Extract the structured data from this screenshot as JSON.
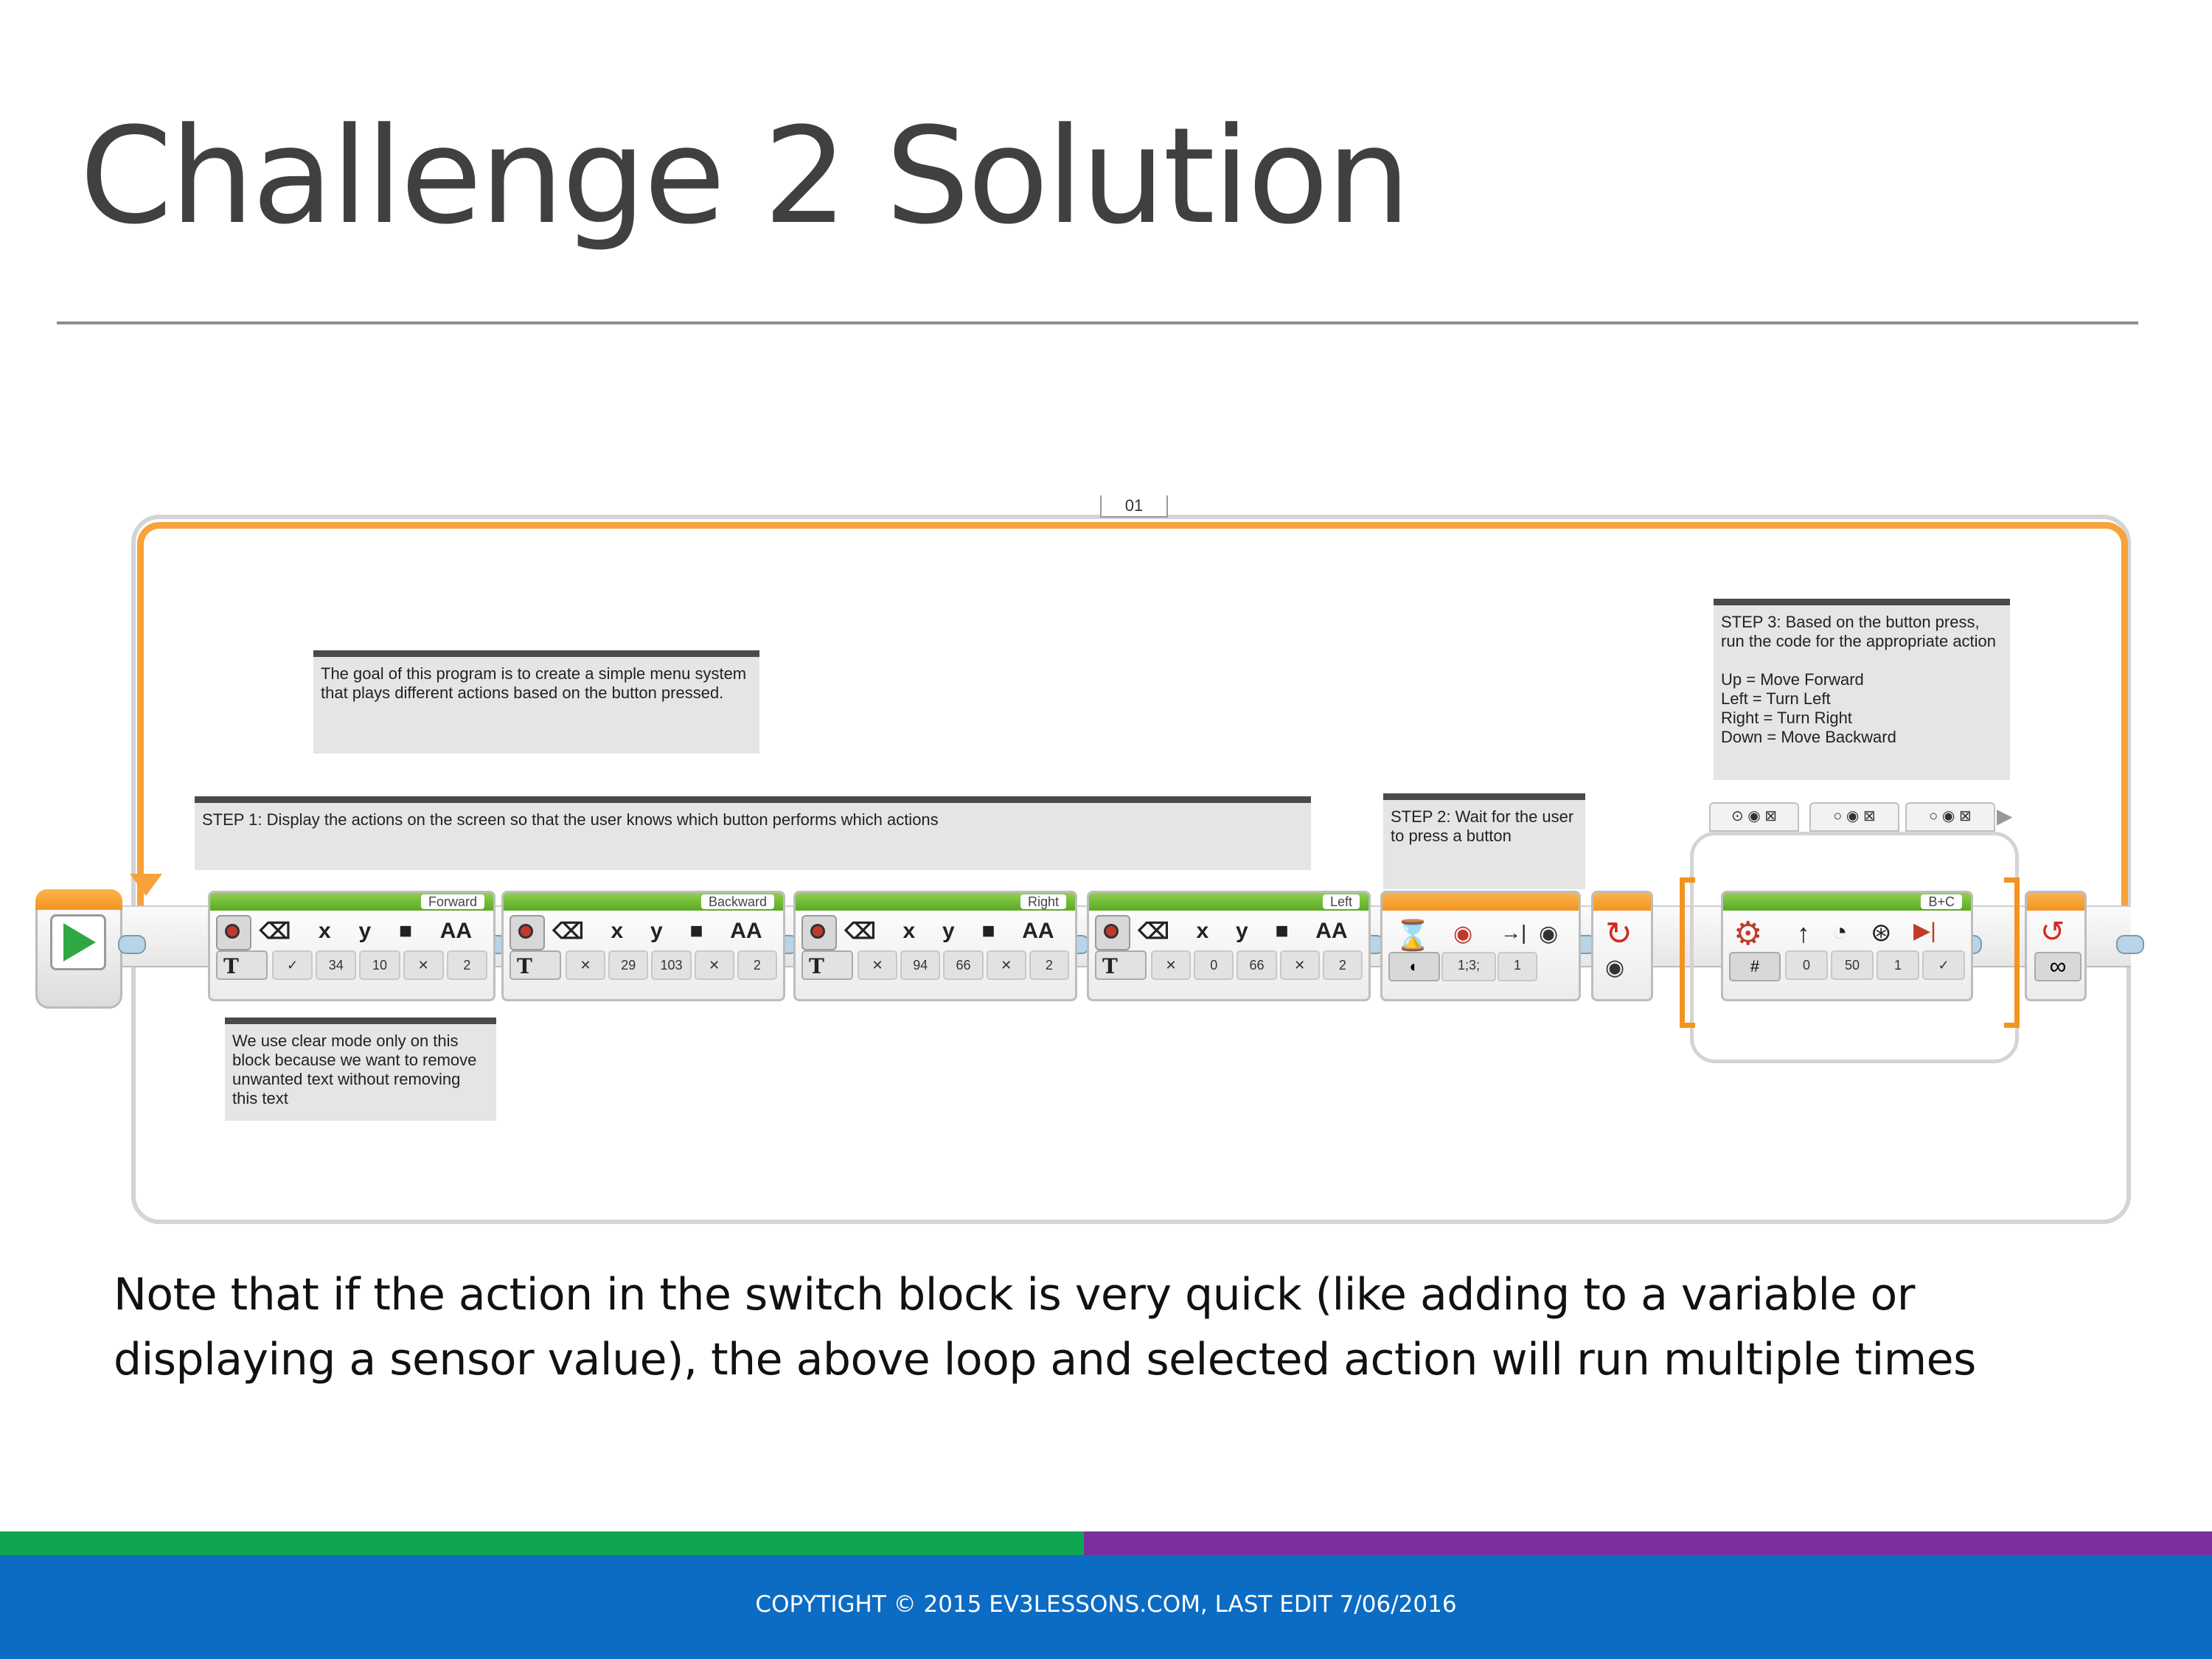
{
  "slide": {
    "title": "Challenge 2 Solution",
    "note": "Note that if the action in the switch block is very quick (like adding to a variable or displaying a sensor value), the above loop and selected action will run multiple times",
    "footer": "COPYTIGHT © 2015 EV3LESSONS.COM, LAST EDIT 7/06/2016"
  },
  "program": {
    "loop_label": "01",
    "comments": {
      "goal": "The goal of this program is to create a simple menu system that plays different actions based on the button pressed.",
      "step1": "STEP 1: Display the actions on the screen so that the user knows which button performs which actions",
      "clear_mode": "We use clear mode only on this block because we want to remove unwanted text without removing this text",
      "step2": "STEP 2: Wait for the user to press a button",
      "step3": "STEP 3: Based on the button press, run the code for the appropriate action\n\nUp = Move Forward\nLeft = Turn Left\nRight = Turn Right\nDown = Move Backward"
    },
    "display_blocks": [
      {
        "label": "Forward",
        "clear": "✓",
        "x": "34",
        "y": "10",
        "color": "✕",
        "size": "2"
      },
      {
        "label": "Backward",
        "clear": "✕",
        "x": "29",
        "y": "103",
        "color": "✕",
        "size": "2"
      },
      {
        "label": "Right",
        "clear": "✕",
        "x": "94",
        "y": "66",
        "color": "✕",
        "size": "2"
      },
      {
        "label": "Left",
        "clear": "✕",
        "x": "0",
        "y": "66",
        "color": "✕",
        "size": "2"
      }
    ],
    "wait_block": {
      "ports": "1;3;",
      "value": "1"
    },
    "move_block": {
      "label": "B+C",
      "steer": "0",
      "power": "50",
      "rotations": "1",
      "brake": "✓"
    },
    "loop_end": {
      "count": "∞"
    },
    "icon_glyphs": {
      "x": "x",
      "y": "y",
      "aa": "AA",
      "t": "T"
    },
    "colors": {
      "loop": "#f7a23a",
      "display_head": "#6fbd2e",
      "start": "#2fa844",
      "footer_blue": "#0c6cc4",
      "bar_green": "#0fa650",
      "bar_purple": "#7b2f9f"
    }
  }
}
